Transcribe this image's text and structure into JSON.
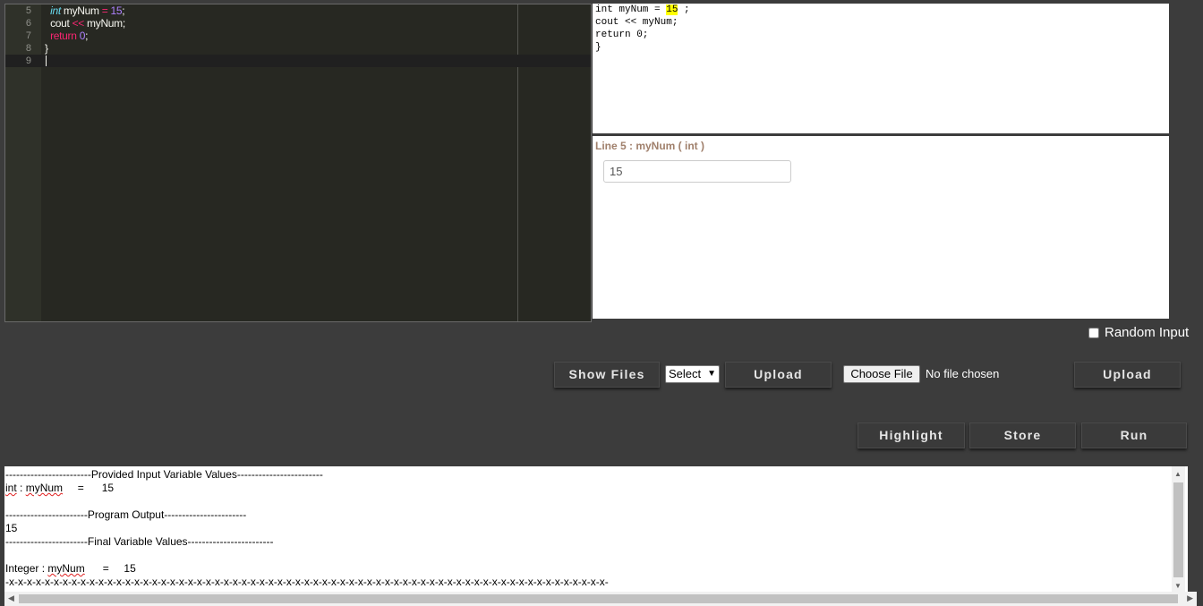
{
  "editor": {
    "lines": [
      {
        "num": "5",
        "tokens": [
          {
            "t": "  ",
            "c": ""
          },
          {
            "t": "int",
            "c": "kw-type"
          },
          {
            "t": " myNum ",
            "c": ""
          },
          {
            "t": "=",
            "c": "op"
          },
          {
            "t": " ",
            "c": ""
          },
          {
            "t": "15",
            "c": "num"
          },
          {
            "t": ";",
            "c": ""
          }
        ]
      },
      {
        "num": "6",
        "tokens": [
          {
            "t": "  cout ",
            "c": ""
          },
          {
            "t": "<<",
            "c": "op"
          },
          {
            "t": " myNum;",
            "c": ""
          }
        ]
      },
      {
        "num": "7",
        "tokens": [
          {
            "t": "  ",
            "c": ""
          },
          {
            "t": "return",
            "c": "kw"
          },
          {
            "t": " ",
            "c": ""
          },
          {
            "t": "0",
            "c": "num"
          },
          {
            "t": ";",
            "c": ""
          }
        ]
      },
      {
        "num": "8",
        "tokens": [
          {
            "t": "}",
            "c": ""
          }
        ]
      },
      {
        "num": "9",
        "tokens": []
      }
    ],
    "active_line": "9"
  },
  "code_view": {
    "line1_pre": "int myNum = ",
    "line1_highlight": "15",
    "line1_post": " ;",
    "line2": "cout << myNum;",
    "line3": "return 0;",
    "line4": "}"
  },
  "variable_panel": {
    "title": "Line 5 : myNum ( int )",
    "input_value": "15"
  },
  "controls": {
    "random_input_label": "Random Input",
    "show_files": "Show Files",
    "select_value": "Select",
    "upload_1": "Upload",
    "choose_file": "Choose File",
    "no_file": "No file chosen",
    "upload_2": "Upload",
    "highlight": "Highlight",
    "store": "Store",
    "run": "Run"
  },
  "output": {
    "input_header_left": "------------------------",
    "input_header_title": "Provided Input Variable Values",
    "input_header_right": "------------------------",
    "input_type": "int",
    "input_sep": " : ",
    "input_var": "myNum",
    "input_eq": "     =      15",
    "program_header_left": "-----------------------",
    "program_header_title": "Program Output",
    "program_header_right": "-----------------------",
    "program_output": "15",
    "final_header_left": "-----------------------",
    "final_header_title": "Final Variable Values",
    "final_header_right": "------------------------",
    "final_type": "Integer : ",
    "final_var": "myNum",
    "final_eq": "      =     15",
    "terminator": "-x-x-x-x-x-x-x-x-x-x-x-x-x-x-x-x-x-x-x-x-x-x-x-x-x-x-x-x-x-x-x-x-x-x-x-x-x-x-x-x-x-x-x-x-x-x-x-x-x-x-x-x-x-x-x-x-x-x-x-x-x-x-x-x-x-x-x-"
  }
}
